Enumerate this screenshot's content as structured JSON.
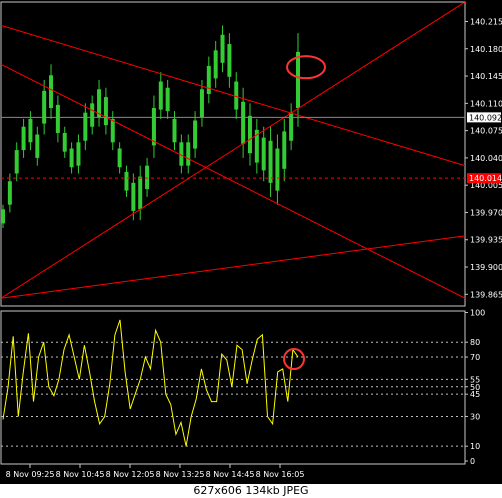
{
  "caption": "627x606  134kb  JPEG",
  "colors": {
    "background": "#000000",
    "frame": "#c8c8c8",
    "candle": "#33cc33",
    "trendline": "#ff0000",
    "stochastic": "#ffff00",
    "level_line": "#c0c0c0",
    "text": "#ffffff",
    "marker": "#ff3333",
    "price_box": "#ffffff",
    "red_box": "#ff0000"
  },
  "chart_data": [
    {
      "type": "candlestick",
      "title": "",
      "ylim": [
        139.85,
        140.24
      ],
      "y_ticks": [
        "140.215",
        "140.180",
        "140.145",
        "140.110",
        "140.075",
        "140.040",
        "140.005",
        "139.970",
        "139.935",
        "139.900",
        "139.865"
      ],
      "y_tick_values": [
        140.215,
        140.18,
        140.145,
        140.11,
        140.075,
        140.04,
        140.005,
        139.97,
        139.935,
        139.9,
        139.865
      ],
      "current_price": {
        "value": 140.092,
        "label": "140.092"
      },
      "red_level": {
        "value": 140.014,
        "label": "140.014"
      },
      "series": [
        {
          "highs": [
            139.98,
            140.02,
            140.06,
            140.09,
            140.1,
            140.08,
            140.14,
            140.16,
            140.12,
            140.08,
            140.06,
            140.07,
            140.11,
            140.12,
            140.14,
            140.13,
            140.1,
            140.06,
            140.03,
            140.02,
            140.03,
            140.04,
            140.12,
            140.15,
            140.14,
            140.1,
            140.07,
            140.07,
            140.1,
            140.14,
            140.17,
            140.19,
            140.21,
            140.2,
            140.15,
            140.13,
            140.11,
            140.09,
            140.08,
            140.08,
            140.07,
            140.09,
            140.11,
            140.2
          ],
          "lows": [
            139.95,
            139.97,
            140.01,
            140.04,
            140.05,
            140.03,
            140.07,
            140.09,
            140.06,
            140.04,
            140.02,
            140.02,
            140.05,
            140.07,
            140.08,
            140.07,
            140.05,
            140.02,
            139.99,
            139.96,
            139.96,
            139.99,
            140.04,
            140.09,
            140.09,
            140.05,
            140.02,
            140.02,
            140.04,
            140.08,
            140.11,
            140.13,
            140.15,
            140.13,
            140.09,
            140.04,
            140.03,
            140.02,
            140.01,
            139.99,
            139.98,
            140.01,
            140.05,
            140.08
          ]
        }
      ],
      "trendlines": [
        {
          "from": [
            0,
            140.21
          ],
          "to": [
            1,
            140.03
          ]
        },
        {
          "from": [
            0,
            139.86
          ],
          "to": [
            1,
            140.24
          ]
        },
        {
          "from": [
            0,
            140.16
          ],
          "to": [
            1,
            139.86
          ]
        },
        {
          "from": [
            0,
            139.86
          ],
          "to": [
            1,
            139.94
          ]
        }
      ]
    },
    {
      "type": "line",
      "title": "",
      "ylim": [
        -2,
        101
      ],
      "y_ticks": [
        "100",
        "80",
        "70",
        "55",
        "50",
        "45",
        "30",
        "10",
        "0"
      ],
      "y_tick_values": [
        100,
        80,
        70,
        55,
        50,
        45,
        30,
        10,
        0
      ],
      "levels": [
        80,
        70,
        55,
        50,
        45,
        30,
        10
      ],
      "x_labels": [
        "8 Nov 09:25",
        "8 Nov 10:45",
        "8 Nov 12:05",
        "8 Nov 13:25",
        "8 Nov 14:45",
        "8 Nov 16:05"
      ],
      "series": [
        {
          "values": [
            28,
            50,
            84,
            30,
            60,
            86,
            40,
            70,
            80,
            50,
            44,
            55,
            75,
            85,
            70,
            55,
            78,
            60,
            40,
            25,
            30,
            52,
            85,
            95,
            60,
            35,
            45,
            55,
            70,
            62,
            88,
            80,
            45,
            38,
            18,
            26,
            10,
            30,
            42,
            62,
            48,
            40,
            40,
            72,
            68,
            50,
            78,
            75,
            52,
            68,
            82,
            85,
            30,
            25,
            60,
            62,
            40,
            75,
            70
          ]
        }
      ]
    }
  ]
}
